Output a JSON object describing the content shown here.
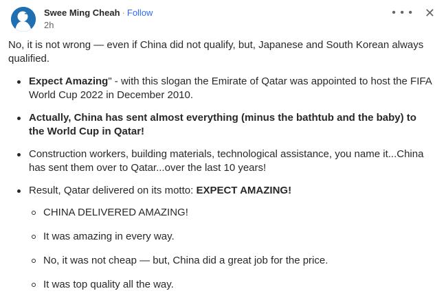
{
  "header": {
    "author": "Swee Ming Cheah",
    "separator": "·",
    "follow_label": "Follow",
    "timestamp": "2h",
    "more_label": "• • •",
    "close_label": "✕"
  },
  "icons": {
    "avatar": "avatar-silhouette",
    "more": "more-options-icon",
    "close": "close-icon"
  },
  "colors": {
    "follow": "#2e69ff",
    "text": "#282829",
    "muted": "#636466"
  },
  "content": {
    "intro": "No, it is not wrong — even if China did not qualify, but, Japanese and South Korean always qualified.",
    "bullets": [
      {
        "bold": "Expect Amazing",
        "text": "\" - with this slogan the Emirate of Qatar was appointed to host the FIFA World Cup 2022 in December 2010."
      },
      {
        "bold": "Actually, China has sent almost everything (minus the bathtub and the baby) to the World Cup in Qatar!"
      },
      {
        "text": "Construction workers, building materials, technological assistance, you name it...China has sent them over to Qatar...over the last 10 years!"
      },
      {
        "text": "Result, Qatar delivered on its motto: ",
        "bold": "EXPECT AMAZING!",
        "sub": [
          "CHINA DELIVERED AMAZING!",
          "It was amazing in every way.",
          "No, it was not cheap — but, China did a great job for the price.",
          "It was top quality all the way."
        ]
      }
    ]
  }
}
